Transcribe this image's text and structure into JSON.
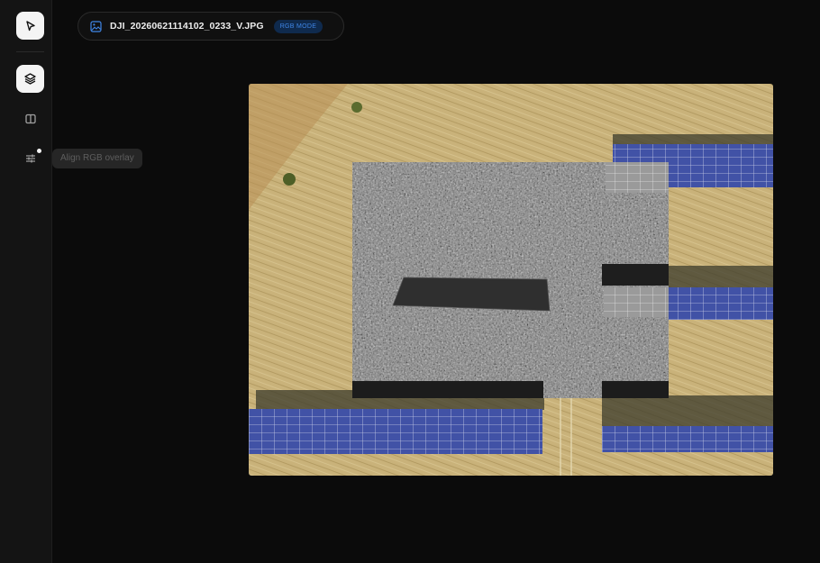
{
  "toolbar": {
    "tools": [
      {
        "name": "select",
        "icon": "cursor-icon",
        "active": true
      },
      {
        "name": "layers",
        "icon": "layers-icon",
        "active": true
      },
      {
        "name": "split-view",
        "icon": "split-view-icon",
        "active": false
      },
      {
        "name": "align",
        "icon": "sliders-icon",
        "active": false
      }
    ],
    "tooltip": "Align RGB overlay"
  },
  "file": {
    "icon": "image-icon",
    "name": "DJI_20260621114102_0233_V.JPG",
    "mode": "RGB MODE"
  },
  "viewer": {
    "image": "aerial-solar-field",
    "overlay": "thermal-grayscale"
  },
  "colors": {
    "background": "#0b0b0b",
    "sidebar": "#141414",
    "accent": "#3f86e6",
    "badge_bg": "#0f2a4d"
  }
}
